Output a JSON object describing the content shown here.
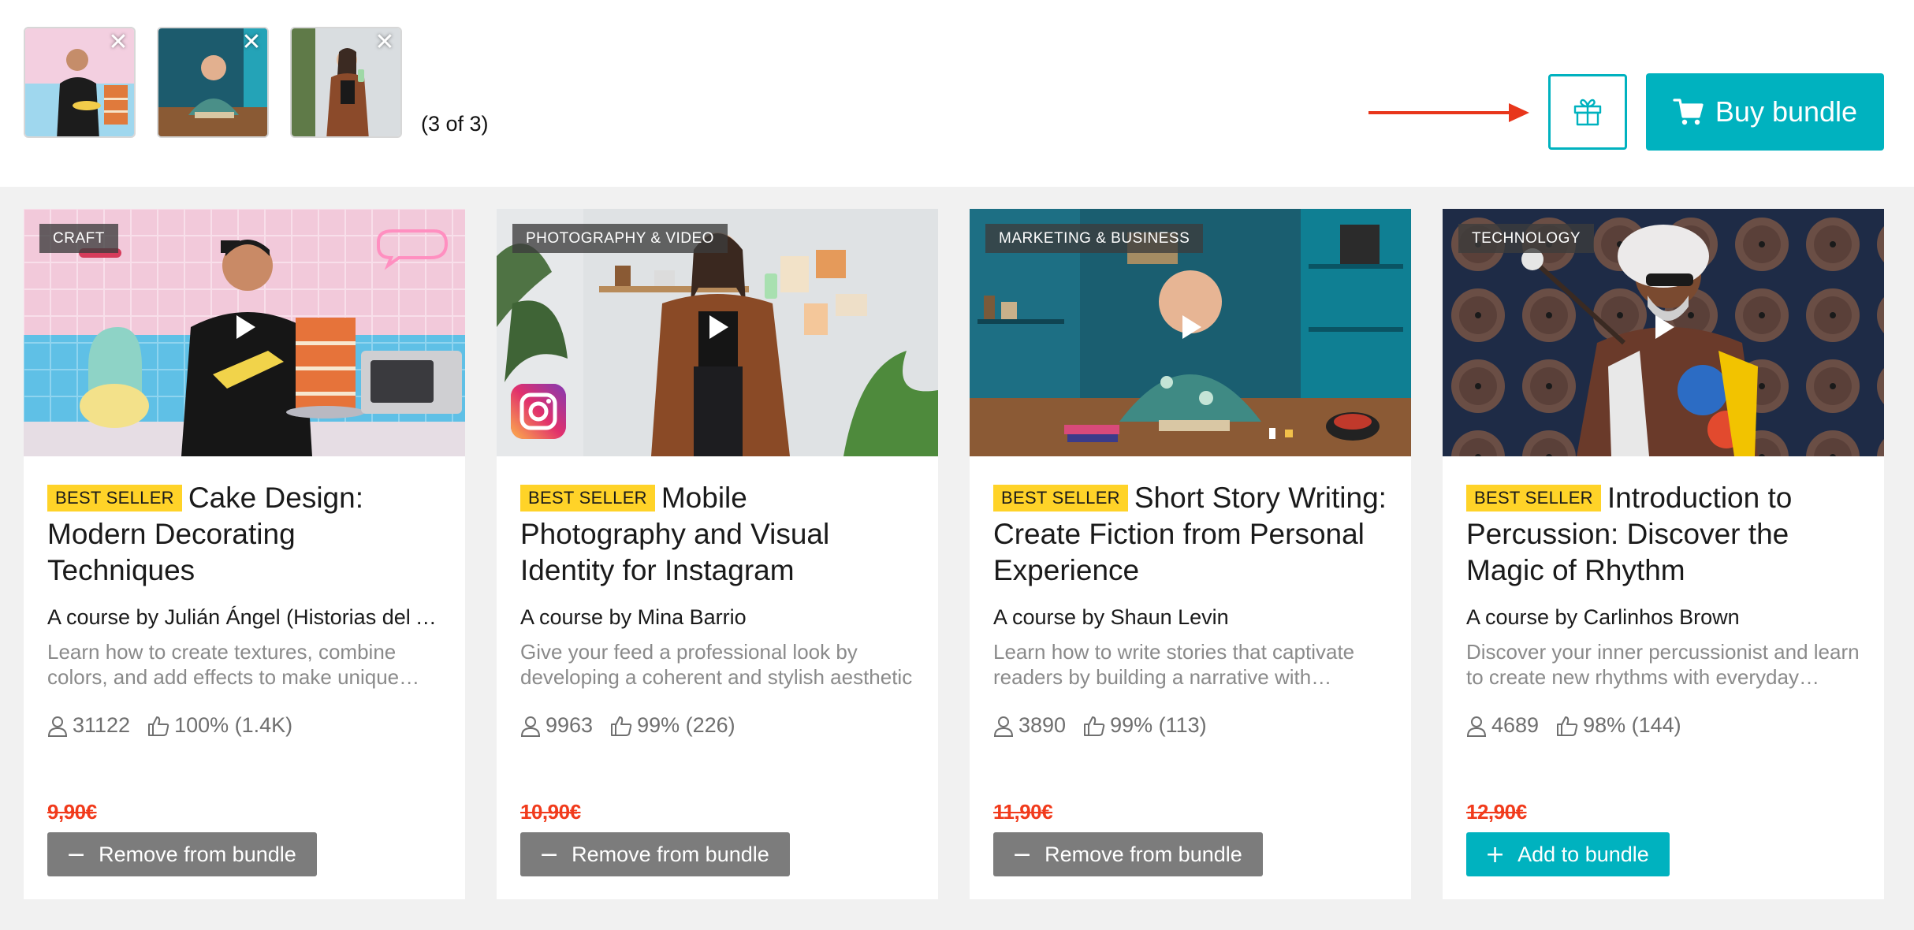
{
  "bundle": {
    "count_text": "(3 of 3)",
    "thumbnails": [
      {
        "label": "Cake design thumbnail"
      },
      {
        "label": "Short story thumbnail"
      },
      {
        "label": "Mobile photography thumbnail"
      }
    ],
    "close_glyph": "✕",
    "buy_label": "Buy bundle"
  },
  "colors": {
    "accent": "#00b2bf",
    "badge": "#ffd328",
    "price_strike": "#f13b1c",
    "remove_button": "#7c7c7c",
    "arrow": "#e8361b"
  },
  "icons": {
    "gift": "gift-icon",
    "cart": "cart-icon",
    "play": "play-icon",
    "students": "user-icon",
    "rating": "thumbs-up-icon",
    "remove": "minus-icon",
    "add": "plus-icon"
  },
  "courses": [
    {
      "category": "CRAFT",
      "badge": "BEST SELLER",
      "title": "Cake Design: Modern Decorating Techniques",
      "author": "A course by Julián Ángel (Historias del Azúcar)",
      "description": "Learn how to create textures, combine colors, and add effects to make unique designs",
      "students": "31122",
      "rating": "100% (1.4K)",
      "price": "9,90€",
      "action_symbol": "−",
      "action_label": "Remove from bundle"
    },
    {
      "category": "PHOTOGRAPHY & VIDEO",
      "badge": "BEST SELLER",
      "title": "Mobile Photography and Visual Identity for Instagram",
      "author": "A course by Mina Barrio",
      "description": "Give your feed a professional look by developing a coherent and stylish aesthetic",
      "students": "9963",
      "rating": "99% (226)",
      "price": "10,90€",
      "action_symbol": "−",
      "action_label": "Remove from bundle"
    },
    {
      "category": "MARKETING & BUSINESS",
      "badge": "BEST SELLER",
      "title": "Short Story Writing: Create Fiction from Personal Experience",
      "author": "A course by Shaun Levin",
      "description": "Learn how to write stories that captivate readers by building a narrative with emotion",
      "students": "3890",
      "rating": "99% (113)",
      "price": "11,90€",
      "action_symbol": "−",
      "action_label": "Remove from bundle"
    },
    {
      "category": "TECHNOLOGY",
      "badge": "BEST SELLER",
      "title": "Introduction to Percussion: Discover the Magic of Rhythm",
      "author": "A course by Carlinhos Brown",
      "description": "Discover your inner percussionist and learn to create new rhythms with everyday objects",
      "students": "4689",
      "rating": "98% (144)",
      "price": "12,90€",
      "action_symbol": "+",
      "action_label": "Add to bundle"
    }
  ]
}
